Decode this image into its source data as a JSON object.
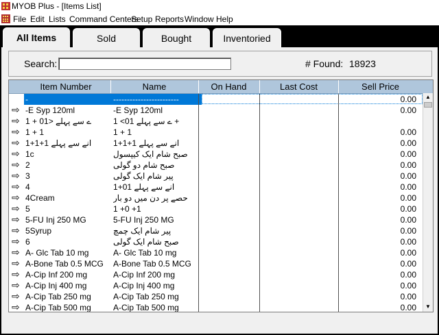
{
  "window": {
    "title": "MYOB Plus - [Items List]"
  },
  "menu": [
    "File",
    "Edit",
    "Lists",
    "Command Centers",
    "Setup",
    "Reports",
    "Window",
    "Help"
  ],
  "tabs": [
    {
      "label": "All Items",
      "active": true
    },
    {
      "label": "Sold",
      "active": false
    },
    {
      "label": "Bought",
      "active": false
    },
    {
      "label": "Inventoried",
      "active": false
    }
  ],
  "search": {
    "label": "Search:",
    "value": ""
  },
  "found": {
    "label": "# Found:",
    "value": "18923"
  },
  "columns": [
    "Item Number",
    "Name",
    "On Hand",
    "Last Cost",
    "Sell Price"
  ],
  "rows": [
    {
      "item": "-",
      "name": "------------------------",
      "price": "0.00",
      "selected": true
    },
    {
      "item": "-E Syp 120ml",
      "name": "-E Syp 120ml",
      "price": "0.00"
    },
    {
      "item": "1 + 01> ے سے پہلے",
      "name": "ے سے پہلے 01> 1 +",
      "price": ""
    },
    {
      "item": "1 + 1",
      "name": "1 + 1",
      "price": "0.00"
    },
    {
      "item": "1+1+1 انے سے پہلے",
      "name": "انے سے پہلے 1+1+1",
      "price": "0.00"
    },
    {
      "item": "1c",
      "name": "صبح شام ایک کیپسول",
      "price": "0.00"
    },
    {
      "item": "2",
      "name": "صبح شام دو گولی",
      "price": "0.00"
    },
    {
      "item": "3",
      "name": "پیر شام ایک گولی",
      "price": "0.00"
    },
    {
      "item": "4",
      "name": "انے سے پہلے 01+1",
      "price": "0.00"
    },
    {
      "item": "4Cream",
      "name": "حصے پر دن میں دو بار",
      "price": "0.00"
    },
    {
      "item": "5",
      "name": "1 +0 +1",
      "price": "0.00"
    },
    {
      "item": "5-FU Inj 250 MG",
      "name": "5-FU Inj 250 MG",
      "price": "0.00"
    },
    {
      "item": "5Syrup",
      "name": "پیر شام ایک چمچ",
      "price": "0.00"
    },
    {
      "item": "6",
      "name": "صبح شام ایک گولی",
      "price": "0.00"
    },
    {
      "item": "A- Glc Tab 10 mg",
      "name": "A- Glc Tab 10 mg",
      "price": "0.00"
    },
    {
      "item": "A-Bone Tab 0.5 MCG",
      "name": "A-Bone Tab 0.5 MCG",
      "price": "0.00"
    },
    {
      "item": "A-Cip Inf 200 mg",
      "name": "A-Cip Inf 200 mg",
      "price": "0.00"
    },
    {
      "item": "A-Cip Inj 400 mg",
      "name": "A-Cip Inj 400 mg",
      "price": "0.00"
    },
    {
      "item": "A-Cip Tab 250 mg",
      "name": "A-Cip Tab 250 mg",
      "price": "0.00"
    },
    {
      "item": "A-Cip Tab 500 mg",
      "name": "A-Cip Tab 500 mg",
      "price": "0.00"
    }
  ],
  "icons": {
    "row_arrow": "right-arrow-icon",
    "app": "myob-app-icon"
  },
  "colors": {
    "header_bg": "#afc6dc",
    "selection": "#0078d7",
    "background": "#000000"
  }
}
